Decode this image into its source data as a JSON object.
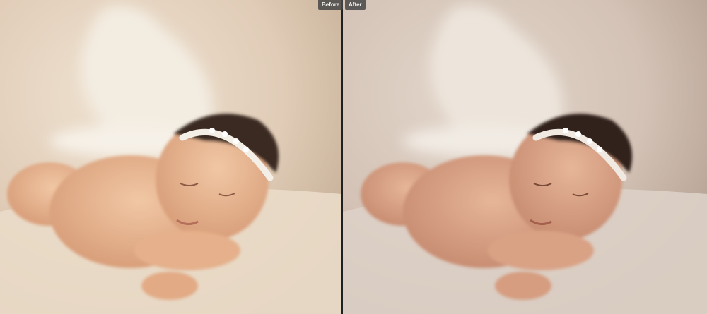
{
  "labels": {
    "before": "Before",
    "after": "After"
  },
  "colors": {
    "before_bg": "#e4d3bf",
    "before_bg_dark": "#c9b29a",
    "before_skin": "#e9bb98",
    "after_bg": "#d7c7ba",
    "after_bg_dark": "#b9a396",
    "after_skin": "#ddab8f",
    "blanket": "#efe6da",
    "headband": "#f4efe6",
    "hair": "#3b2a22",
    "divider": "#202020"
  },
  "icons": {
    "photo": "baby-photo"
  }
}
